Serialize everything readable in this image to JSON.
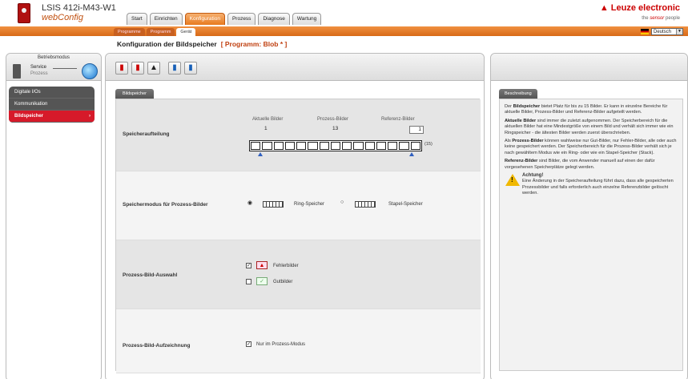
{
  "header": {
    "device_name": "LSIS 412i-M43-W1",
    "app_name": "webConfig",
    "brand": "Leuze electronic",
    "tagline_prefix": "the ",
    "tagline_sensor": "sensor",
    "tagline_suffix": " people"
  },
  "main_tabs": [
    {
      "label": "Start"
    },
    {
      "label": "Einrichten"
    },
    {
      "label": "Konfiguration"
    },
    {
      "label": "Prozess"
    },
    {
      "label": "Diagnose"
    },
    {
      "label": "Wartung"
    }
  ],
  "sub_tabs": [
    {
      "label": "Programme"
    },
    {
      "label": "Programm"
    },
    {
      "label": "Gerät"
    }
  ],
  "language": {
    "selected": "Deutsch"
  },
  "page": {
    "title": "Konfiguration der Bildspeicher",
    "program": "[ Programm: Blob * ]"
  },
  "mode": {
    "title": "Betriebsmodus",
    "service": "Service",
    "process": "Prozess"
  },
  "nav": [
    {
      "label": "Digitale I/Os"
    },
    {
      "label": "Kommunikation"
    },
    {
      "label": "Bildspeicher"
    }
  ],
  "content_tab": "Bildspeicher",
  "memory_split": {
    "label": "Speicheraufteilung",
    "current_header": "Aktuelle Bilder",
    "process_header": "Prozess-Bilder",
    "reference_header": "Referenz-Bilder",
    "current_value": "1",
    "process_value": "13",
    "reference_value": "1",
    "slots": 15,
    "max_label": "(15)"
  },
  "memory_mode": {
    "label": "Speichermodus für Prozess-Bilder",
    "ring_label": "Ring-Speicher",
    "stack_label": "Stapel-Speicher",
    "selected": "ring"
  },
  "process_selection": {
    "label": "Prozess-Bild-Auswahl",
    "error_label": "Fehlerbilder",
    "error_checked": true,
    "good_label": "Gutbilder",
    "good_checked": false
  },
  "process_recording": {
    "label": "Prozess-Bild-Aufzeichnung",
    "only_process_label": "Nur im Prozess-Modus",
    "only_process_checked": true
  },
  "description": {
    "tab": "Beschreibung",
    "p1_a": "Der ",
    "p1_b": "Bildspeicher",
    "p1_c": " bietet Platz für bis zu 15 Bilder. Er kann in einzelne Bereiche für aktuelle Bilder, Prozess-Bilder und Referenz-Bilder aufgeteilt werden.",
    "p2_b": "Aktuelle Bilder",
    "p2_c": " sind immer die zuletzt aufgenommen. Der Speicherbereich für die aktuellen Bilder hat eine Mindestgröße von einem Bild und verhält sich immer wie ein Ringspeicher - die ältesten Bilder werden zuerst überschrieben.",
    "p3_a": "Als ",
    "p3_b": "Prozess-Bilder",
    "p3_c": " können wahlweise nur Gut-Bilder, nur Fehler-Bilder, alle oder auch keine gespeichert werden. Der Speicherbereich für die Prozess-Bilder verhält sich je nach gewähltem Modus wie ein Ring- oder wie ein Stapel-Speicher (Stack).",
    "p4_b": "Referenz-Bilder",
    "p4_c": " sind Bilder, die vom Anwender manuell auf einen der dafür vorgesehenen Speicherplätze gelegt werden.",
    "warn_title": "Achtung!",
    "warn_text": "Eine Änderung in der Speicheraufteilung führt dazu, dass alle gespeicherten Prozessbilder und falls erforderlich auch einzelne Referenzbilder gelöscht werden."
  }
}
